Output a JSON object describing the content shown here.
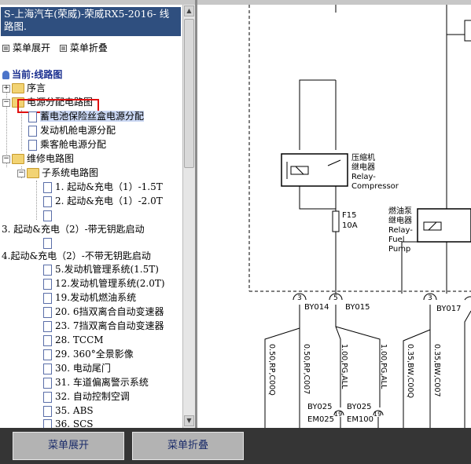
{
  "header": {
    "title": "S-上海汽车(荣威)-荣威RX5-2016- 线路图."
  },
  "menu": {
    "expand": "菜单展开",
    "collapse": "菜单折叠"
  },
  "current": "当前:线路图",
  "tree": [
    "序言",
    "电源分配电路图",
    "蓄电池保险丝盒电源分配",
    "发动机舱电源分配",
    "乘客舱电源分配",
    "维修电路图",
    "子系统电路图",
    "1. 起动&充电（1）-1.5T",
    "2. 起动&充电（1）-2.0T",
    "3. 起动&充电（2）-带无钥匙启动",
    "4.起动&充电（2）-不带无钥匙启动",
    "5.发动机管理系统(1.5T)",
    "12.发动机管理系统(2.0T)",
    "19.发动机燃油系统",
    "20. 6挡双离合自动变速器",
    "23. 7挡双离合自动变速器",
    "28. TCCM",
    "29. 360°全景影像",
    "30. 电动尾门",
    "31. 车道偏离警示系统",
    "32. 自动控制空调",
    "35. ABS",
    "36. SCS"
  ],
  "diagram": {
    "relay1": [
      "压缩机",
      "继电器",
      "Relay-",
      "Compressor"
    ],
    "fuse": [
      "F15",
      "10A"
    ],
    "relay2": [
      "燃油泵",
      "继电器",
      "Relay-",
      "Fuel",
      "Pump"
    ],
    "pins": [
      "3",
      "5",
      "3"
    ],
    "connectors": [
      "BY014",
      "BY015",
      "BY017"
    ],
    "wires": [
      "0.50,RP,C00Q",
      "0.50,RP,C007",
      "1.00,PG,ALL",
      "1.00,PG,ALL",
      "0.35,BW,C00Q",
      "0.35,BW,C007"
    ],
    "bottom_labels": [
      "BY025",
      "EM025",
      "BY025",
      "EM100"
    ],
    "bottom_pins": [
      "19",
      "19"
    ]
  },
  "bottom_bar": {
    "expand": "菜单展开",
    "collapse": "菜单折叠"
  }
}
